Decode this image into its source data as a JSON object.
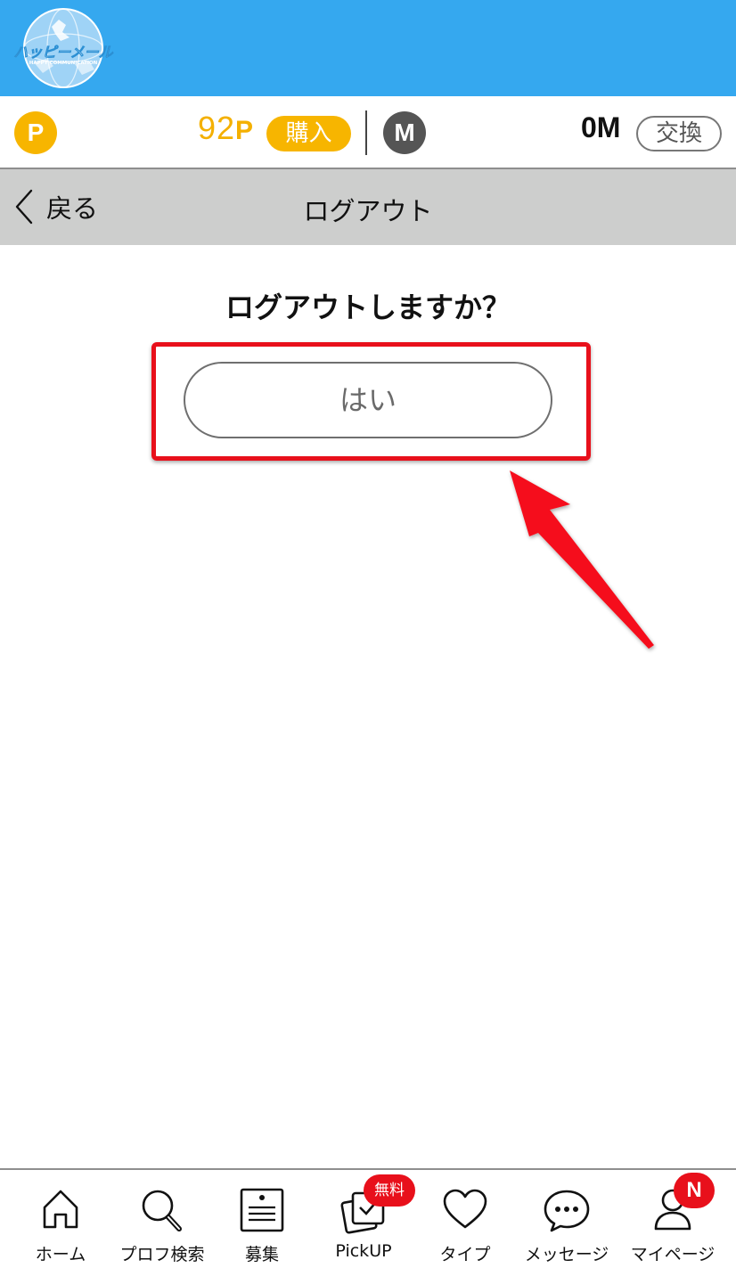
{
  "header": {
    "logo_text": "ハッピーメール",
    "logo_subtext": "HAPPY COMMUNICATION",
    "background_color": "#35a8ef"
  },
  "points_bar": {
    "point_coin_label": "P",
    "point_value": "92",
    "point_unit": "P",
    "buy_label": "購入",
    "mile_coin_label": "M",
    "mile_value": "0M",
    "exchange_label": "交換",
    "accent_color": "#f7b500"
  },
  "nav": {
    "back_label": "戻る",
    "title": "ログアウト"
  },
  "main": {
    "question": "ログアウトしますか？",
    "yes_label": "はい",
    "highlight_color": "#e8101b"
  },
  "tab_bar": {
    "tabs": [
      {
        "label": "ホーム",
        "icon": "home-icon"
      },
      {
        "label": "プロフ検索",
        "icon": "search-icon"
      },
      {
        "label": "募集",
        "icon": "board-icon"
      },
      {
        "label": "PickUP",
        "icon": "pickup-icon"
      },
      {
        "label": "タイプ",
        "icon": "heart-icon"
      },
      {
        "label": "メッセージ",
        "icon": "message-icon"
      },
      {
        "label": "マイページ",
        "icon": "person-icon"
      }
    ],
    "pickup_badge": "無料",
    "mypage_badge": "N"
  }
}
